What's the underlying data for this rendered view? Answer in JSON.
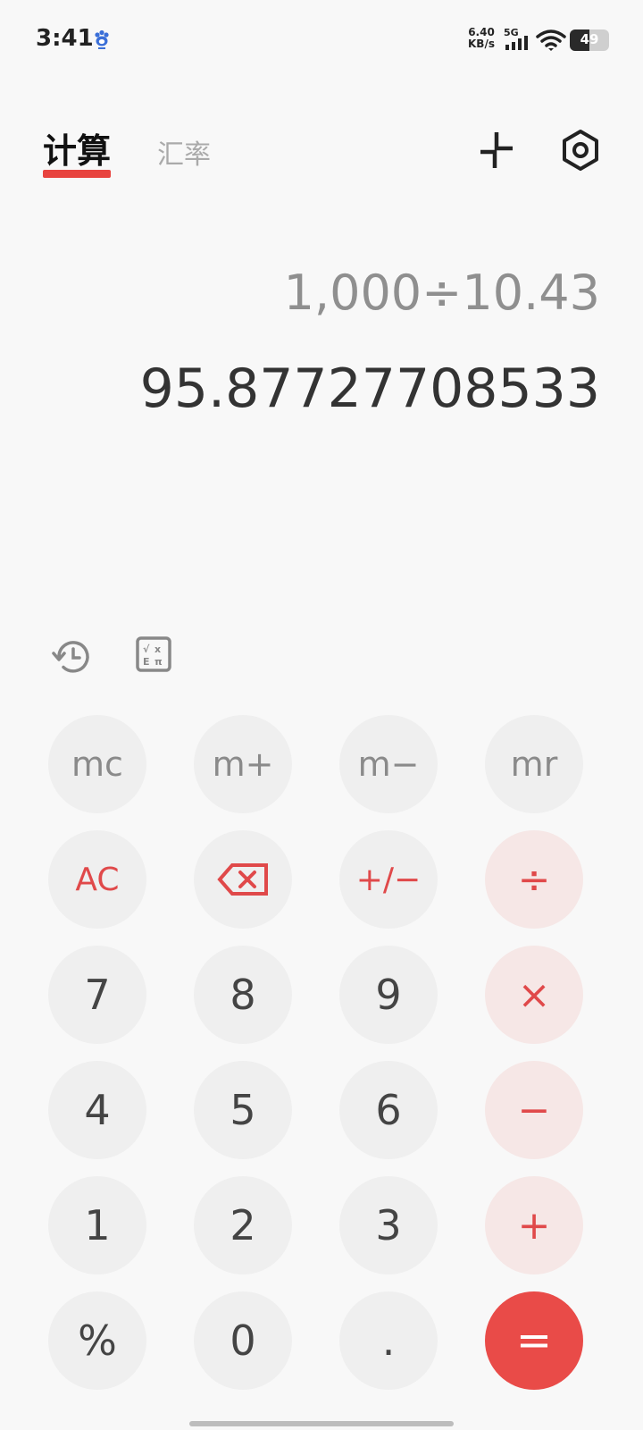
{
  "status": {
    "time": "3:41",
    "app_icon": "baidu-paw-icon",
    "net_speed_value": "6.40",
    "net_speed_unit": "KB/s",
    "network_type": "5G",
    "battery": "49",
    "battery_level": 0.49
  },
  "tabs": {
    "calculate": "计算",
    "exchange": "汇率"
  },
  "header": {
    "collapse_icon": "collapse-arrows-icon",
    "settings_icon": "settings-hexagon-icon"
  },
  "display": {
    "expression": "1,000÷10.43",
    "result": "95.87727708533"
  },
  "tools": {
    "history_icon": "history-clock-icon",
    "scientific_icon": "scientific-mode-icon"
  },
  "keys": {
    "mc": "mc",
    "m_plus": "m+",
    "m_minus": "m−",
    "mr": "mr",
    "ac": "AC",
    "plus_minus": "+/−",
    "divide": "÷",
    "seven": "7",
    "eight": "8",
    "nine": "9",
    "multiply": "×",
    "four": "4",
    "five": "5",
    "six": "6",
    "minus": "−",
    "one": "1",
    "two": "2",
    "three": "3",
    "plus": "+",
    "percent": "%",
    "zero": "0",
    "dot": ".",
    "equals": "="
  },
  "colors": {
    "accent": "#e94b48",
    "operator_bg": "#f6e7e6",
    "key_bg": "#efefef",
    "background": "#f8f8f8"
  }
}
